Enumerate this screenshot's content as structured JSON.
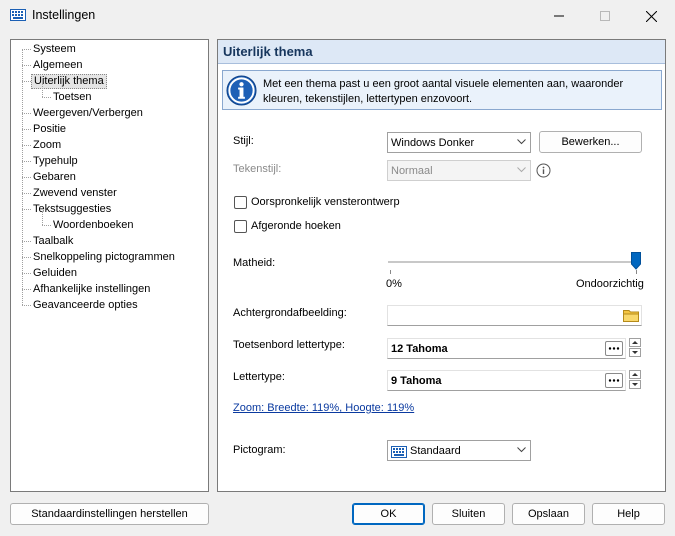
{
  "window": {
    "title": "Instellingen",
    "controls": {
      "minimize": "minimize-icon",
      "maximize": "maximize-icon",
      "close": "close-icon"
    }
  },
  "tree": {
    "items": [
      {
        "label": "Systeem",
        "level": 0
      },
      {
        "label": "Algemeen",
        "level": 0
      },
      {
        "label": "Uiterlijk thema",
        "level": 0,
        "selected": true
      },
      {
        "label": "Toetsen",
        "level": 1
      },
      {
        "label": "Weergeven/Verbergen",
        "level": 0
      },
      {
        "label": "Positie",
        "level": 0
      },
      {
        "label": "Zoom",
        "level": 0
      },
      {
        "label": "Typehulp",
        "level": 0
      },
      {
        "label": "Gebaren",
        "level": 0
      },
      {
        "label": "Zwevend venster",
        "level": 0
      },
      {
        "label": "Tekstsuggesties",
        "level": 0
      },
      {
        "label": "Woordenboeken",
        "level": 1
      },
      {
        "label": "Taalbalk",
        "level": 0
      },
      {
        "label": "Snelkoppeling pictogrammen",
        "level": 0
      },
      {
        "label": "Geluiden",
        "level": 0
      },
      {
        "label": "Afhankelijke instellingen",
        "level": 0
      },
      {
        "label": "Geavanceerde opties",
        "level": 0
      }
    ]
  },
  "panel": {
    "title": "Uiterlijk thema",
    "info": "Met een thema past u een groot aantal visuele elementen aan, waaronder kleuren, tekenstijlen, lettertypen enzovoort.",
    "style_label": "Stijl:",
    "style_value": "Windows Donker",
    "edit_button": "Bewerken...",
    "font_style_label": "Tekenstijl:",
    "font_style_value": "Normaal",
    "original_design_label": "Oorspronkelijk vensterontwerp",
    "original_design_checked": false,
    "rounded_corners_label": "Afgeronde hoeken",
    "rounded_corners_checked": false,
    "opacity_label": "Matheid:",
    "opacity_min_label": "0%",
    "opacity_max_label": "Ondoorzichtig",
    "opacity_value_percent": 100,
    "background_image_label": "Achtergrondafbeelding:",
    "background_image_value": "",
    "keyboard_font_label": "Toetsenbord lettertype:",
    "keyboard_font_value": "12 Tahoma",
    "font_label": "Lettertype:",
    "font_value": "9 Tahoma",
    "zoom_link": "Zoom: Breedte: 119%, Hoogte: 119%",
    "icon_label": "Pictogram:",
    "icon_value": "Standaard"
  },
  "footer": {
    "reset_button": "Standaardinstellingen herstellen",
    "ok_button": "OK",
    "close_button": "Sluiten",
    "save_button": "Opslaan",
    "help_button": "Help"
  },
  "colors": {
    "accent": "#0067c0",
    "header_bg": "#dde8f6",
    "link": "#0a3aa0"
  }
}
